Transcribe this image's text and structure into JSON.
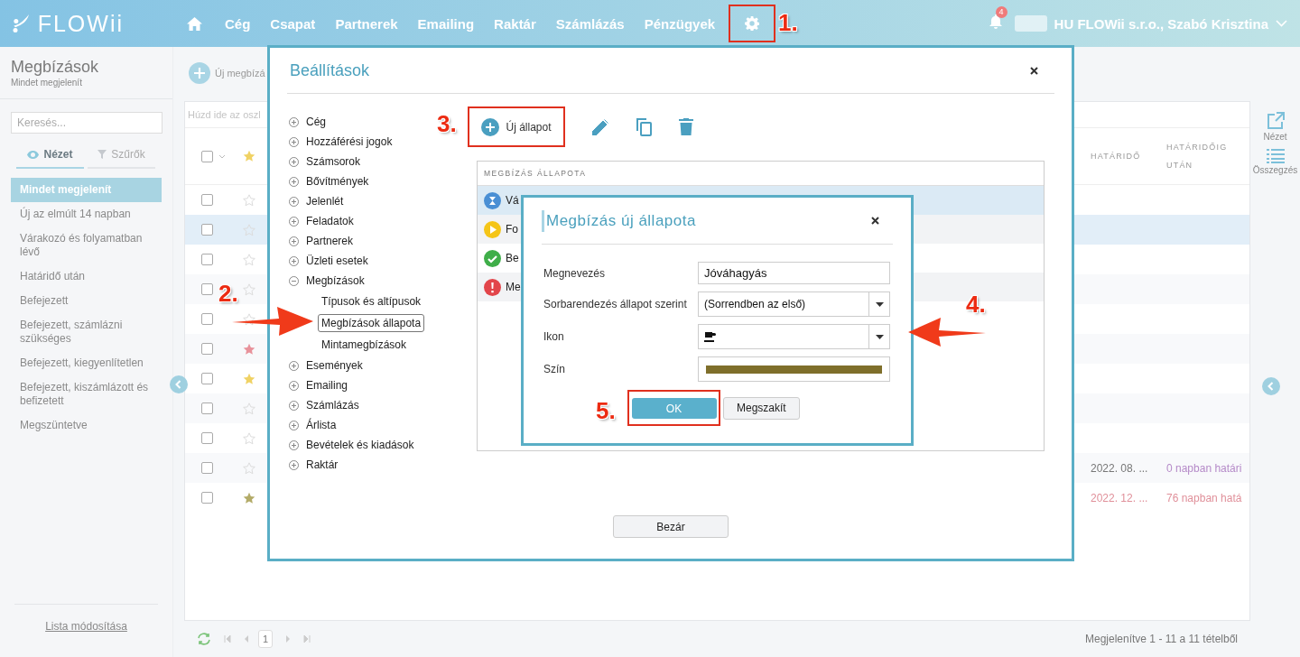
{
  "top_bar": {
    "logo": "FLOWii",
    "nav": [
      {
        "label": "Cég"
      },
      {
        "label": "Csapat"
      },
      {
        "label": "Partnerek"
      },
      {
        "label": "Emailing"
      },
      {
        "label": "Raktár"
      },
      {
        "label": "Számlázás"
      },
      {
        "label": "Pénzügyek"
      }
    ],
    "notifications": "4",
    "account": "HU FLOWii s.r.o., Szabó Krisztina"
  },
  "sidebar": {
    "title": "Megbízások",
    "subtitle": "Mindet megjelenít",
    "search": {
      "placeholder": "Keresés..."
    },
    "tabs": [
      {
        "label": "Nézet",
        "selected": true
      },
      {
        "label": "Szűrők",
        "selected": false
      }
    ],
    "items": [
      {
        "label": "Mindet megjelenít",
        "selected": true
      },
      {
        "label": "Új az elmúlt 14 napban",
        "selected": false
      },
      {
        "label": "Várakozó és folyamatban lévő",
        "selected": false
      },
      {
        "label": "Határidő után",
        "selected": false
      },
      {
        "label": "Befejezett",
        "selected": false
      },
      {
        "label": "Befejezett, számlázni szükséges",
        "selected": false
      },
      {
        "label": "Befejezett, kiegyenlítetlen",
        "selected": false
      },
      {
        "label": "Befejezett, kiszámlázott és befizetett",
        "selected": false
      },
      {
        "label": "Megszüntetve",
        "selected": false
      }
    ],
    "footer_link": "Lista módosítása"
  },
  "toolbar": {
    "new_button": "Új megbízá"
  },
  "table": {
    "group_hint": "Húzd ide az oszl",
    "select_all": {
      "checked": false
    },
    "columns": [
      {
        "label": "HATÁRIDŐ"
      },
      {
        "label": "HATÁRIDŐIG UTÁN"
      }
    ],
    "rows": [
      {
        "selected": false,
        "starred": false
      },
      {
        "selected": true,
        "starred": false
      },
      {
        "selected": false,
        "starred": false
      },
      {
        "selected": false,
        "starred": false
      },
      {
        "selected": false,
        "starred": false
      },
      {
        "selected": false,
        "starred": true,
        "color": "#e8929b"
      },
      {
        "selected": false,
        "starred": true,
        "color": "#f0d264"
      },
      {
        "selected": false,
        "starred": false
      },
      {
        "selected": false,
        "starred": false
      },
      {
        "selected": false,
        "starred": false,
        "deadline": {
          "kind": "today",
          "date": "2022. 08. ...",
          "remaining": "0 napban határi"
        }
      },
      {
        "selected": false,
        "starred": true,
        "color": "#b3ab68",
        "deadline": {
          "kind": "future",
          "date": "2022. 12. ...",
          "remaining": "76 napban hatá"
        }
      }
    ],
    "page": "1",
    "summary": "Megjelenítve 1 - 11 a 11 tételből"
  },
  "side_rail": [
    {
      "kind": "view",
      "label": "Nézet"
    },
    {
      "kind": "summary",
      "label": "Összegzés"
    }
  ],
  "settings_dialog": {
    "title": "Beállítások",
    "tree": [
      {
        "label": "Cég",
        "expanded": false
      },
      {
        "label": "Hozzáférési jogok",
        "expanded": false
      },
      {
        "label": "Számsorok",
        "expanded": false
      },
      {
        "label": "Bővítmények",
        "expanded": false
      },
      {
        "label": "Jelenlét",
        "expanded": false
      },
      {
        "label": "Feladatok",
        "expanded": false
      },
      {
        "label": "Partnerek",
        "expanded": false
      },
      {
        "label": "Üzleti esetek",
        "expanded": false
      },
      {
        "label": "Megbízások",
        "expanded": true,
        "children": [
          {
            "label": "Típusok és altípusok",
            "selected": false
          },
          {
            "label": "Megbízások állapota",
            "selected": true
          },
          {
            "label": "Mintamegbízások",
            "selected": false
          }
        ]
      },
      {
        "label": "Események",
        "expanded": false
      },
      {
        "label": "Emailing",
        "expanded": false
      },
      {
        "label": "Számlázás",
        "expanded": false
      },
      {
        "label": "Árlista",
        "expanded": false
      },
      {
        "label": "Bevételek és kiadások",
        "expanded": false
      },
      {
        "label": "Raktár",
        "expanded": false
      }
    ],
    "new_button": "Új állapot",
    "list_header": "MEGBÍZÁS ÁLLAPOTA",
    "statuses": [
      {
        "kind": "waiting",
        "label": "Vá",
        "selected": true
      },
      {
        "kind": "in_progress",
        "label": "Fo",
        "selected": false
      },
      {
        "kind": "done",
        "label": "Be",
        "selected": false
      },
      {
        "kind": "cancelled",
        "label": "Me",
        "selected": false
      }
    ],
    "close_button": "Bezár"
  },
  "new_status_dialog": {
    "title": "Megbízás új állapota",
    "fields": [
      {
        "kind": "text",
        "label": "Megnevezés",
        "value": "Jóváhagyás"
      },
      {
        "kind": "select",
        "label": "Sorbarendezés állapot szerint",
        "value": "(Sorrendben az első)"
      },
      {
        "kind": "icon_select",
        "label": "Ikon"
      },
      {
        "kind": "color",
        "label": "Szín",
        "color": "#7f6f2b"
      }
    ],
    "ok_button": "OK",
    "cancel_button": "Megszakít"
  },
  "annotations": [
    {
      "label": "1."
    },
    {
      "label": "2."
    },
    {
      "label": "3."
    },
    {
      "label": "4."
    },
    {
      "label": "5."
    }
  ]
}
